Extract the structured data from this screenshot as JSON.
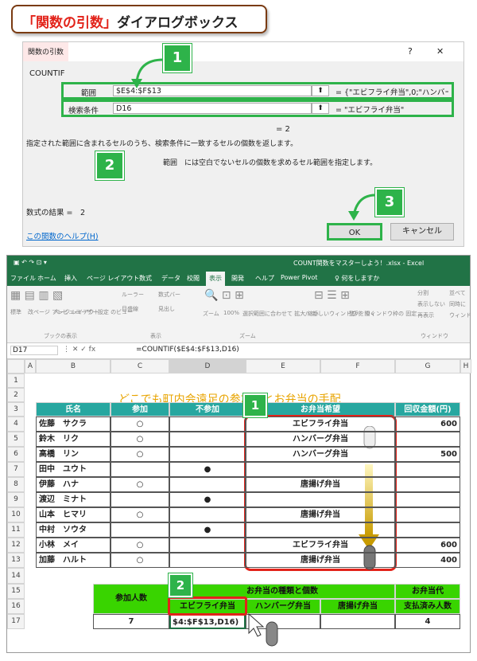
{
  "heading": {
    "red": "「関数の引数」",
    "black": "ダイアログボックス"
  },
  "dialog": {
    "title": "関数の引数",
    "help_q": "?",
    "close": "✕",
    "func_name": "COUNTIF",
    "arg1": {
      "label": "範囲",
      "value": "$E$4:$F$13",
      "result": "= {\"エビフライ弁当\",0;\"ハンバーグ弁当\",0;\"ハンバー"
    },
    "arg2": {
      "label": "検索条件",
      "value": "D16",
      "result": "= \"エビフライ弁当\""
    },
    "total": "= 2",
    "description": "指定された範囲に含まれるセルのうち、検索条件に一致するセルの個数を返します。",
    "arg_help": "範囲　には空白でないセルの個数を求めるセル範囲を指定します。",
    "formula_result": "数式の結果 =　2",
    "help_link": "この関数のヘルプ(H)",
    "ok": "OK",
    "cancel": "キャンセル"
  },
  "callouts": [
    "1",
    "2",
    "3",
    "1",
    "2"
  ],
  "excel": {
    "window_title": "COUNT関数をマスターしよう！.xlsx  -  Excel",
    "tabs": [
      "ファイル",
      "ホーム",
      "挿入",
      "ページ レイアウト",
      "数式",
      "データ",
      "校閲",
      "表示",
      "開発",
      "ヘルプ",
      "Power Pivot",
      "♀ 何をしますか"
    ],
    "ribbon": {
      "views": [
        "標準",
        "改ページ\nプレビュー",
        "ページ\nレイアウト",
        "ユーザー設定\nのビュー"
      ],
      "group_book_views": "ブックの表示",
      "show": [
        "ルーラー",
        "数式バー",
        "目盛線",
        "見出し"
      ],
      "group_show": "表示",
      "zoom": [
        "ズーム",
        "100%",
        "選択範囲に合わせて\n拡大/縮小"
      ],
      "group_zoom": "ズーム",
      "window": [
        "新しいウィンドウ\nを開く",
        "整列",
        "ウィンドウ枠の\n固定",
        "分割",
        "表示しない",
        "再表示",
        "並べて",
        "同時に",
        "ウィンド"
      ],
      "group_window": "ウィンドウ"
    },
    "name_box": "D17",
    "formula": "=COUNTIF($E$4:$F$13,D16)",
    "columns": [
      "A",
      "B",
      "C",
      "D",
      "E",
      "F",
      "G",
      "H"
    ],
    "rows": [
      "1",
      "2",
      "3",
      "4",
      "5",
      "6",
      "7",
      "8",
      "9",
      "10",
      "11",
      "12",
      "13",
      "14",
      "15",
      "16",
      "17"
    ],
    "sheet_title": "どこでも町内会遠足の参加者とお弁当の手配",
    "headers": [
      "氏名",
      "参加",
      "不参加",
      "お弁当希望",
      "回収金額(円)"
    ],
    "data": [
      [
        "佐藤　サクラ",
        "○",
        "",
        "エビフライ弁当",
        "600"
      ],
      [
        "鈴木　リク",
        "○",
        "",
        "ハンバーグ弁当",
        ""
      ],
      [
        "高橋　リン",
        "○",
        "",
        "ハンバーグ弁当",
        "500"
      ],
      [
        "田中　ユウト",
        "",
        "●",
        "",
        ""
      ],
      [
        "伊藤　ハナ",
        "○",
        "",
        "唐揚げ弁当",
        ""
      ],
      [
        "渡辺　ミナト",
        "",
        "●",
        "",
        ""
      ],
      [
        "山本　ヒマリ",
        "○",
        "",
        "唐揚げ弁当",
        ""
      ],
      [
        "中村　ソウタ",
        "",
        "●",
        "",
        ""
      ],
      [
        "小林　メイ",
        "○",
        "",
        "エビフライ弁当",
        "600"
      ],
      [
        "加藤　ハルト",
        "○",
        "",
        "唐揚げ弁当",
        "400"
      ]
    ],
    "summary": {
      "count_label": "参加人数",
      "bento_label": "お弁当の種類と個数",
      "paid_label1": "お弁当代",
      "paid_label2": "支払済み人数",
      "types": [
        "エビフライ弁当",
        "ハンバーグ弁当",
        "唐揚げ弁当"
      ],
      "count_value": "7",
      "d17": "$4:$F$13,D16)",
      "paid_value": "4"
    }
  },
  "colors": {
    "accent": "#2eb34a",
    "header": "#27a7a0",
    "summary": "#39d400",
    "highlight": "#e2231a",
    "title_text": "#e8a400"
  }
}
